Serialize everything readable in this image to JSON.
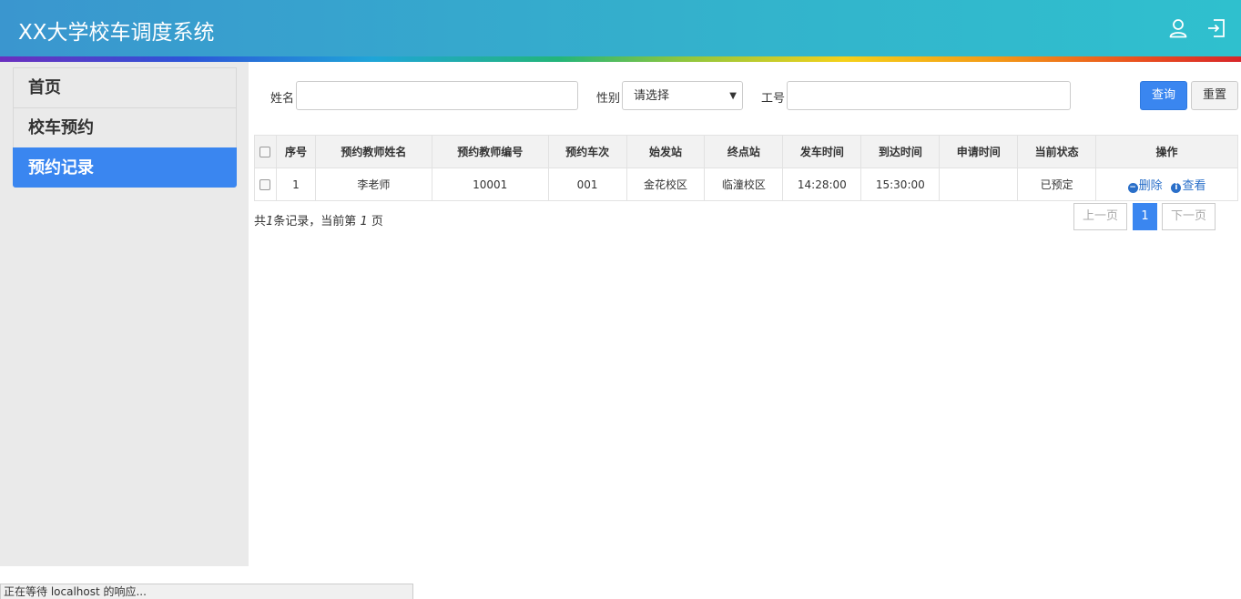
{
  "header": {
    "title": "XX大学校车调度系统",
    "user_icon": "user-icon",
    "logout_icon": "logout-icon"
  },
  "sidebar": {
    "items": [
      {
        "label": "首页"
      },
      {
        "label": "校车预约"
      },
      {
        "label": "预约记录"
      }
    ]
  },
  "search": {
    "name_label": "姓名",
    "name_value": "",
    "gender_label": "性别",
    "gender_selected": "请选择",
    "id_label": "工号",
    "id_value": "",
    "query_label": "查询",
    "reset_label": "重置"
  },
  "table": {
    "headers": [
      "序号",
      "预约教师姓名",
      "预约教师编号",
      "预约车次",
      "始发站",
      "终点站",
      "发车时间",
      "到达时间",
      "申请时间",
      "当前状态",
      "操作"
    ],
    "rows": [
      {
        "index": "1",
        "teacher_name": "李老师",
        "teacher_id": "10001",
        "trip": "001",
        "origin": "金花校区",
        "destination": "临潼校区",
        "depart": "14:28:00",
        "arrive": "15:30:00",
        "apply_time": "",
        "status": "已预定",
        "delete_label": "删除",
        "view_label": "查看"
      }
    ]
  },
  "footer": {
    "summary_prefix": "共",
    "total": "1",
    "summary_mid": "条记录，当前第",
    "page": "1",
    "summary_suffix": "页",
    "prev_label": "上一页",
    "current_page": "1",
    "next_label": "下一页"
  },
  "status_bar": {
    "text": "正在等待 localhost 的响应..."
  },
  "colors": {
    "primary": "#3a86f0",
    "header_start": "#3a96cf",
    "header_end": "#2fc0ce",
    "sidebar_bg": "#eaeaea"
  }
}
